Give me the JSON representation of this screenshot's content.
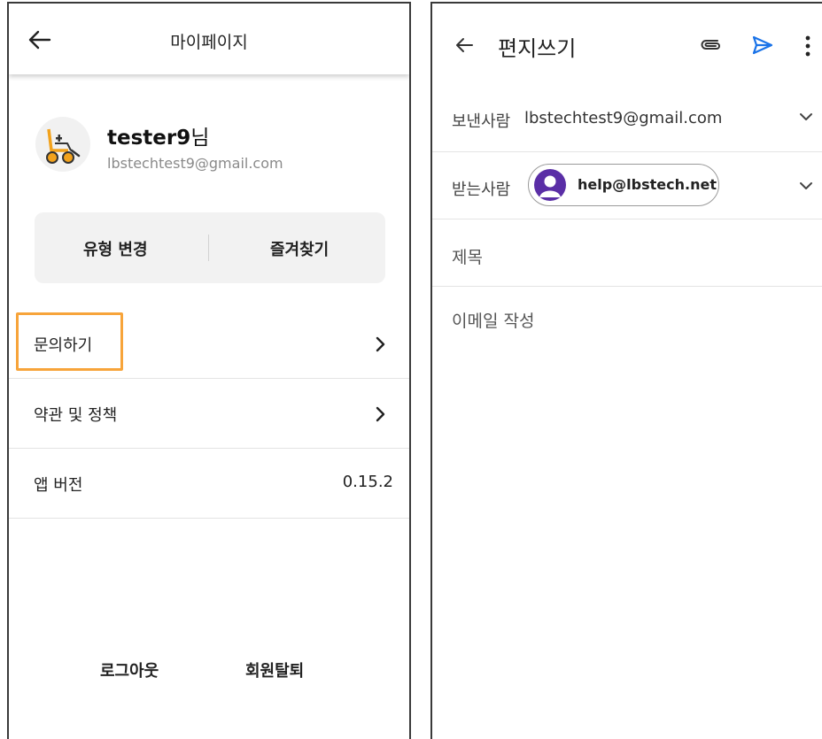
{
  "mypage": {
    "title": "마이페이지",
    "username": "tester9",
    "username_suffix": "님",
    "email": "lbstechtest9@gmail.com",
    "quick_actions": {
      "change_type": "유형 변경",
      "favorites": "즐겨찾기"
    },
    "menu": {
      "inquiry": "문의하기",
      "terms": "약관 및 정책",
      "app_version_label": "앱 버전",
      "app_version_value": "0.15.2"
    },
    "logout": "로그아웃",
    "withdraw": "회원탈퇴",
    "icons": [
      "back-arrow-icon",
      "wheelchair-icon",
      "chevron-right-icon"
    ],
    "highlight_color": "#f7a43a",
    "accent_color": "#f2a21c"
  },
  "compose": {
    "title": "편지쓰기",
    "from_label": "보낸사람",
    "from_value": "lbstechtest9@gmail.com",
    "to_label": "받는사람",
    "to_value": "help@lbstech.net",
    "subject_placeholder": "제목",
    "body_placeholder": "이메일 작성",
    "icons": [
      "back-arrow-icon",
      "attach-icon",
      "send-icon",
      "more-vert-icon",
      "chevron-down-icon",
      "person-avatar-icon"
    ],
    "send_color": "#1a73e8",
    "chip_avatar_color": "#5a2ea6"
  }
}
